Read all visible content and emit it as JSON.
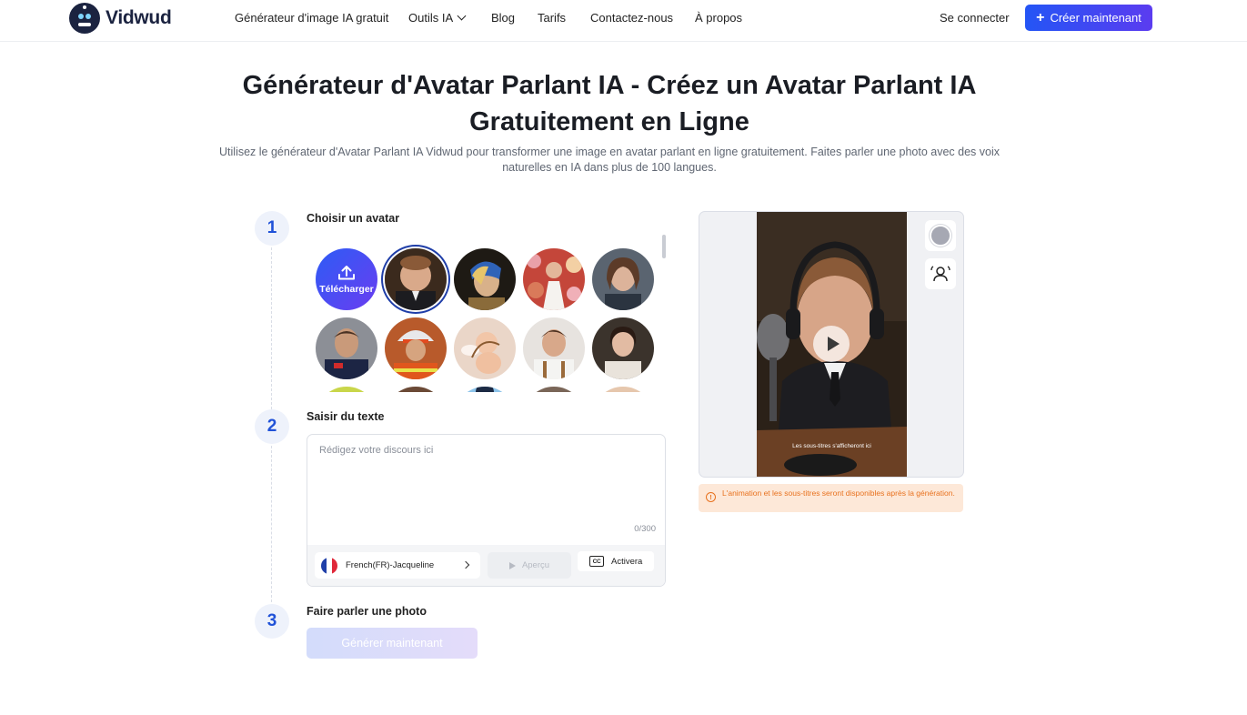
{
  "header": {
    "brand": "Vidwud",
    "nav": [
      {
        "label": "Générateur d'image IA gratuit"
      },
      {
        "label": "Outils IA"
      },
      {
        "label": "Blog"
      },
      {
        "label": "Tarifs"
      },
      {
        "label": "Contactez-nous"
      },
      {
        "label": "À propos"
      }
    ],
    "login": "Se connecter",
    "cta": "Créer maintenant"
  },
  "hero": {
    "title": "Générateur d'Avatar Parlant IA - Créez un Avatar Parlant IA Gratuitement en Ligne",
    "subtitle": "Utilisez le générateur d'Avatar Parlant IA Vidwud pour transformer une image en avatar parlant en ligne gratuitement. Faites parler une photo avec des voix naturelles en IA dans plus de 100 langues."
  },
  "steps": [
    {
      "number": "1",
      "label": "Choisir un avatar"
    },
    {
      "number": "2",
      "label": "Saisir du texte"
    },
    {
      "number": "3",
      "label": "Faire parler une photo"
    }
  ],
  "avatars": {
    "upload_label": "Télécharger",
    "selected_index": 1
  },
  "text_input": {
    "placeholder": "Rédigez votre discours ici",
    "value": "",
    "counter": "0/300",
    "voice": "French(FR)-Jacqueline",
    "preview_label": "Aperçu",
    "captions_label": "Activera",
    "captions_icon": "CC"
  },
  "generate": {
    "label": "Générer maintenant"
  },
  "preview": {
    "subtitle_placeholder": "Les sous-titres s'afficheront ici",
    "notice": "L'animation et les sous-titres seront disponibles après la génération."
  },
  "colors": {
    "accent": "#2455f5",
    "accent2": "#5b3cf0",
    "step": "#2052d8",
    "warning": "#e8721f",
    "warning_bg": "#fde8d8"
  }
}
